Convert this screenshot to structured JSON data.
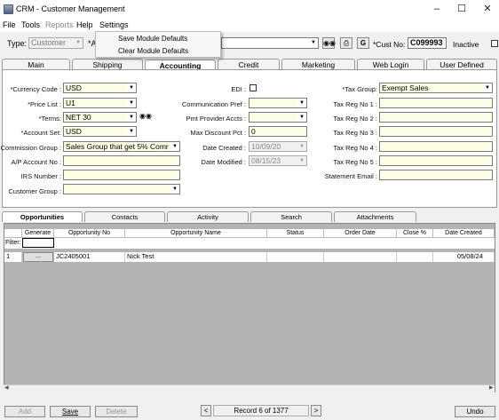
{
  "window": {
    "title": "CRM - Customer Management"
  },
  "menu": {
    "file": "File",
    "tools": "Tools",
    "reports": "Reports",
    "help": "Help",
    "settings": "Settings"
  },
  "settings_menu": {
    "save_defaults": "Save Module Defaults",
    "clear_defaults": "Clear Module Defaults"
  },
  "header": {
    "type_label": "Type:",
    "type_value": "Customer",
    "name_label": "*A",
    "cust_no_label": "*Cust No:",
    "cust_no_value": "C099993",
    "inactive_label": "Inactive",
    "g_button": "G"
  },
  "tabs": [
    "Main",
    "Shipping",
    "Accounting",
    "Credit",
    "Marketing",
    "Web Login",
    "User Defined"
  ],
  "accounting": {
    "currency_code": {
      "label": "*Currency Code :",
      "value": "USD"
    },
    "price_list": {
      "label": "*Price List :",
      "value": "U1"
    },
    "terms": {
      "label": "*Terms:",
      "value": "NET 30"
    },
    "account_set": {
      "label": "*Account Set:",
      "value": "USD"
    },
    "commission_group": {
      "label": "Commission Group :",
      "value": "Sales Group that get 5% Comr"
    },
    "ap_account_no": {
      "label": "A/P Account No :",
      "value": ""
    },
    "irs_number": {
      "label": "IRS Number :",
      "value": ""
    },
    "customer_group": {
      "label": "Customer Group :",
      "value": ""
    },
    "edi": {
      "label": "EDI :"
    },
    "communication_pref": {
      "label": "Communication Pref :",
      "value": ""
    },
    "pmt_provider_accts": {
      "label": "Pmt Provider Accts :",
      "value": ""
    },
    "max_discount_pct": {
      "label": "Max Discount Pct :",
      "value": "0"
    },
    "date_created": {
      "label": "Date Created :",
      "value": "10/09/20"
    },
    "date_modified": {
      "label": "Date Modified :",
      "value": "08/15/23"
    },
    "tax_group": {
      "label": "*Tax Group:",
      "value": "Exempt Sales"
    },
    "tax_reg_1": {
      "label": "Tax Reg No 1 :",
      "value": ""
    },
    "tax_reg_2": {
      "label": "Tax Reg No 2 :",
      "value": ""
    },
    "tax_reg_3": {
      "label": "Tax Reg No 3 :",
      "value": ""
    },
    "tax_reg_4": {
      "label": "Tax Reg No 4 :",
      "value": ""
    },
    "tax_reg_5": {
      "label": "Tax Reg No 5 :",
      "value": ""
    },
    "statement_email": {
      "label": "Statement Email :",
      "value": ""
    }
  },
  "lower_tabs": [
    "Opportunities",
    "Contacts",
    "Activity",
    "Search",
    "Attachments"
  ],
  "grid": {
    "columns": [
      "Generate",
      "Opportunity No",
      "Opportunity Name",
      "Status",
      "Order Date",
      "Close %",
      "Date Created"
    ],
    "filter_label": "Filter:",
    "rows": [
      {
        "index": "1",
        "generate": "...",
        "opportunity_no": "JC2405001",
        "opportunity_name": "Nick Test",
        "status": "",
        "order_date": "",
        "close_pct": "",
        "date_created": "05/08/24"
      }
    ]
  },
  "footer": {
    "add": "Add",
    "save": "Save",
    "delete": "Delete",
    "record": "Record 6 of 1377",
    "undo": "Undo"
  },
  "colors": {
    "required_bg": "#ffffe6",
    "grid_bg": "#b4b4b4"
  }
}
